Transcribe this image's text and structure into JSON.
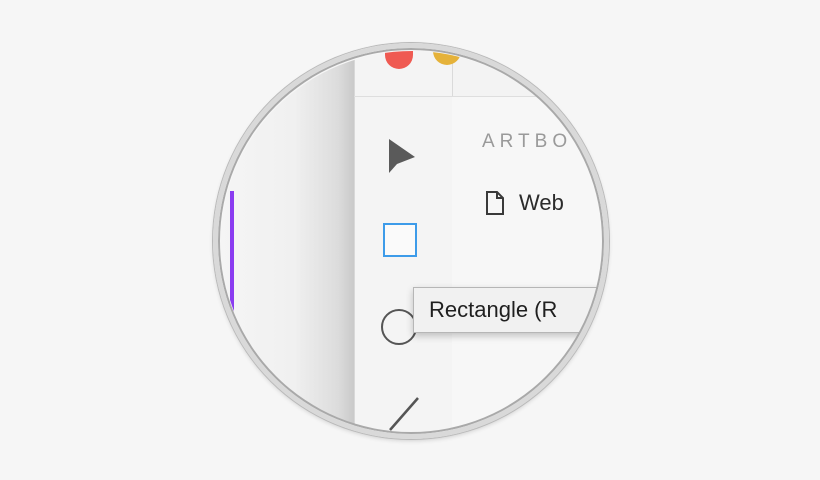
{
  "panel": {
    "section_title": "ARTBO",
    "artboards": [
      {
        "label": "Web",
        "icon": "document-icon"
      }
    ]
  },
  "toolbar": {
    "tools": [
      {
        "name": "select",
        "icon": "arrow-select-icon"
      },
      {
        "name": "rectangle",
        "icon": "rectangle-icon",
        "color": "#3d9be9"
      },
      {
        "name": "ellipse",
        "icon": "ellipse-icon"
      },
      {
        "name": "line",
        "icon": "line-icon"
      }
    ]
  },
  "tooltip": {
    "text": "Rectangle (R"
  },
  "colors": {
    "accent": "#3d9be9",
    "artboard_edge": "#8a3cf0",
    "window_close": "#ef5a52",
    "window_minimize": "#e5b23a"
  }
}
